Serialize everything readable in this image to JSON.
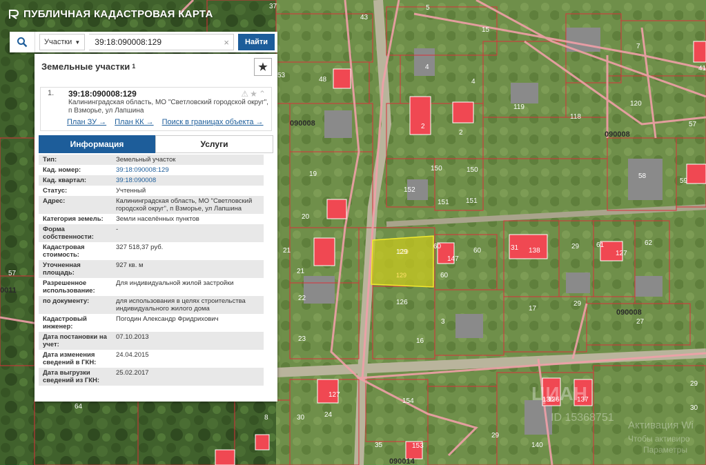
{
  "app": {
    "title": "ПУБЛИЧНАЯ КАДАСТРОВАЯ КАРТА"
  },
  "search": {
    "type_label": "Участки",
    "query": "39:18:090008:129",
    "button": "Найти"
  },
  "panel": {
    "heading": "Земельные участки",
    "heading_count": "1",
    "result": {
      "index": "1.",
      "number": "39:18:090008:129",
      "address": "Калининградская область, МО \"Светловский городской округ\", п Взморье, ул Лапшина",
      "links": [
        "План ЗУ →",
        "План КК →",
        "Поиск в границах объекта →"
      ]
    },
    "tabs": [
      "Информация",
      "Услуги"
    ],
    "attributes": [
      {
        "k": "Тип:",
        "v": "Земельный участок"
      },
      {
        "k": "Кад. номер:",
        "v": "39:18:090008:129"
      },
      {
        "k": "Кад. квартал:",
        "v": "39:18:090008"
      },
      {
        "k": "Статус:",
        "v": "Учтенный"
      },
      {
        "k": "Адрес:",
        "v": "Калининградская область, МО \"Светловский городской округ\", п Взморье, ул Лапшина"
      },
      {
        "k": "Категория земель:",
        "v": "Земли населённых пунктов"
      },
      {
        "k": "Форма собственности:",
        "v": "-"
      },
      {
        "k": "Кадастровая стоимость:",
        "v": "327 518,37 руб."
      },
      {
        "k": "Уточненная площадь:",
        "v": "927 кв. м"
      },
      {
        "k": "Разрешенное использование:",
        "v": "Для индивидуальной жилой застройки"
      },
      {
        "k": "по документу:",
        "v": "для использования в целях строительства индивидуального жилого дома"
      },
      {
        "k": "Кадастровый инженер:",
        "v": "Погодин Александр Фридрихович"
      },
      {
        "k": "Дата постановки на учет:",
        "v": "07.10.2013"
      },
      {
        "k": "Дата изменения сведений в ГКН:",
        "v": "24.04.2015"
      },
      {
        "k": "Дата выгрузки сведений из ГКН:",
        "v": "25.02.2017"
      }
    ]
  },
  "map": {
    "quarter_labels": [
      "090008",
      "090008",
      "090008",
      "090014",
      "0011"
    ],
    "selected_labels": [
      "129",
      "129"
    ],
    "parcel_labels": [
      "37",
      "43",
      "15",
      "5",
      "7",
      "41",
      "53",
      "48",
      "4",
      "4",
      "119",
      "118",
      "120",
      "57",
      "2",
      "2",
      "19",
      "150",
      "150",
      "58",
      "59",
      "152",
      "151",
      "151",
      "20",
      "21",
      "21",
      "129",
      "60",
      "60",
      "60",
      "31",
      "29",
      "61",
      "62",
      "138",
      "22",
      "126",
      "17",
      "29",
      "27",
      "23",
      "3",
      "16",
      "8",
      "127",
      "154",
      "136",
      "137",
      "30",
      "24",
      "29",
      "30",
      "35",
      "153",
      "140",
      "29",
      "64",
      "57",
      "136",
      "147",
      "127"
    ],
    "watermark": {
      "brand": "ЦИАН",
      "id": "ID 15368751",
      "activation": "Активация Wi",
      "activation_sub": "Чтобы активиро",
      "params": "Параметры"
    }
  },
  "colors": {
    "accent": "#1d5d9a",
    "parcel_outline": "#d9303a",
    "selected_fill": "#c8c820"
  }
}
